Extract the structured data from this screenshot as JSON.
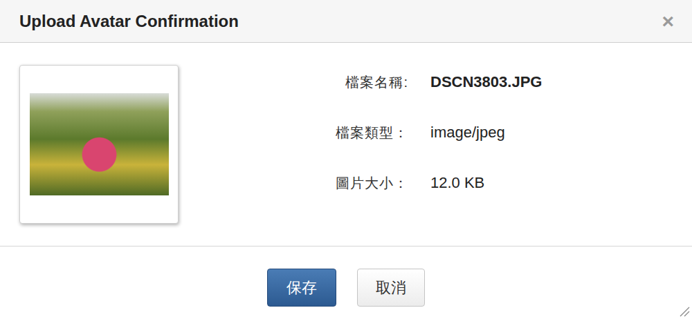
{
  "dialog": {
    "title": "Upload Avatar Confirmation",
    "close": "×"
  },
  "fields": [
    {
      "label": "檔案名稱:",
      "value": "DSCN3803.JPG",
      "emphasis": true
    },
    {
      "label": "檔案類型：",
      "value": "image/jpeg",
      "emphasis": false
    },
    {
      "label": "圖片大小：",
      "value": "12.0 KB",
      "emphasis": false
    }
  ],
  "buttons": [
    {
      "label": "保存",
      "kind": "primary"
    },
    {
      "label": "取消",
      "kind": "default"
    }
  ]
}
